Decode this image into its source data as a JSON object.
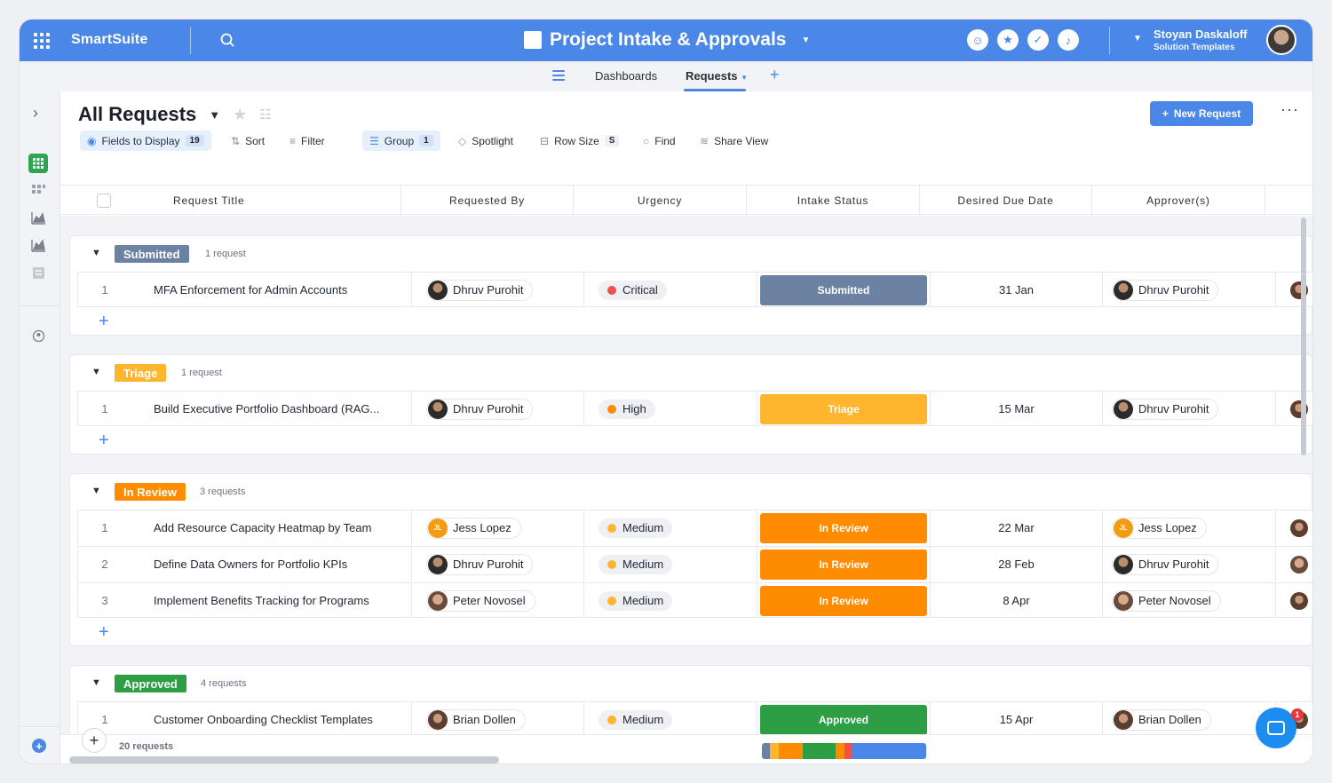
{
  "topbar": {
    "brand": "SmartSuite",
    "app_title": "Project Intake & Approvals",
    "user_name": "Stoyan Daskaloff",
    "user_subtitle": "Solution Templates",
    "icons": [
      "members-icon",
      "star-icon",
      "check-icon",
      "bell-icon"
    ]
  },
  "nav": {
    "tabs": [
      {
        "label": "Dashboards"
      },
      {
        "label": "Requests"
      }
    ]
  },
  "view": {
    "title": "All Requests",
    "new_button": "New Request",
    "toolbar": {
      "fields": "Fields to Display",
      "fields_count": "19",
      "sort": "Sort",
      "filter": "Filter",
      "group": "Group",
      "group_count": "1",
      "spotlight": "Spotlight",
      "row_size": "Row Size",
      "row_size_value": "S",
      "find": "Find",
      "share": "Share View"
    }
  },
  "columns": [
    "Request Title",
    "Requested By",
    "Urgency",
    "Intake Status",
    "Desired Due Date",
    "Approver(s)"
  ],
  "groups": [
    {
      "label": "Submitted",
      "count_text": "1 request",
      "color": "#6b82a3",
      "rows": [
        {
          "n": "1",
          "title": "MFA Enforcement for Admin Accounts",
          "requested_by": "Dhruv Purohit",
          "urgency": "Critical",
          "status": "Submitted",
          "due": "31 Jan",
          "approver": "Dhruv Purohit"
        }
      ]
    },
    {
      "label": "Triage",
      "count_text": "1 request",
      "color": "#ffb52e",
      "rows": [
        {
          "n": "1",
          "title": "Build Executive Portfolio Dashboard (RAG...",
          "requested_by": "Dhruv Purohit",
          "urgency": "High",
          "status": "Triage",
          "due": "15 Mar",
          "approver": "Dhruv Purohit"
        }
      ]
    },
    {
      "label": "In Review",
      "count_text": "3 requests",
      "color": "#ff8b00",
      "rows": [
        {
          "n": "1",
          "title": "Add Resource Capacity Heatmap by Team",
          "requested_by": "Jess Lopez",
          "urgency": "Medium",
          "status": "In Review",
          "due": "22 Mar",
          "approver": "Jess Lopez"
        },
        {
          "n": "2",
          "title": "Define Data Owners for Portfolio KPIs",
          "requested_by": "Dhruv Purohit",
          "urgency": "Medium",
          "status": "In Review",
          "due": "28 Feb",
          "approver": "Dhruv Purohit"
        },
        {
          "n": "3",
          "title": "Implement Benefits Tracking for Programs",
          "requested_by": "Peter Novosel",
          "urgency": "Medium",
          "status": "In Review",
          "due": "8 Apr",
          "approver": "Peter Novosel"
        }
      ]
    },
    {
      "label": "Approved",
      "count_text": "4 requests",
      "color": "#2e9e45",
      "rows": [
        {
          "n": "1",
          "title": "Customer Onboarding Checklist Templates",
          "requested_by": "Brian Dollen",
          "urgency": "Medium",
          "status": "Approved",
          "due": "15 Apr",
          "approver": "Brian Dollen"
        }
      ]
    }
  ],
  "jess_initials": "JL",
  "urgency_colors": {
    "Critical": "#f0504f",
    "High": "#ff8b00",
    "Medium": "#ffb52e"
  },
  "footer": {
    "total": "20 requests",
    "chat_badge": "1"
  }
}
